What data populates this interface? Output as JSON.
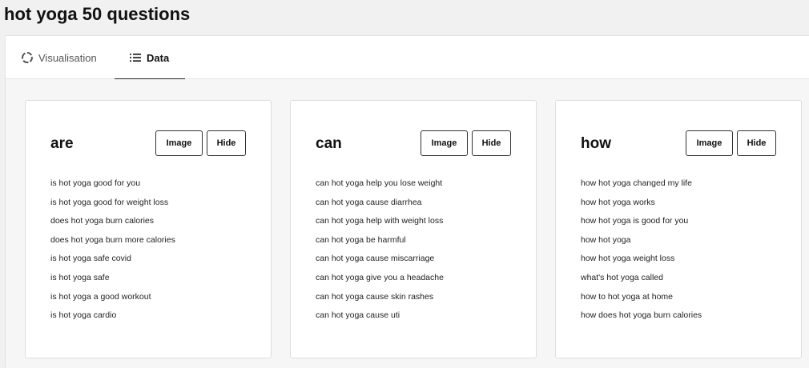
{
  "header": {
    "keyword": "hot yoga",
    "suffix": "50 questions"
  },
  "tabs": [
    {
      "label": "Visualisation",
      "icon": "loading-circle-icon",
      "active": false
    },
    {
      "label": "Data",
      "icon": "list-icon",
      "active": true
    }
  ],
  "cards": [
    {
      "title": "are",
      "image_label": "Image",
      "hide_label": "Hide",
      "questions": [
        "is hot yoga good for you",
        "is hot yoga good for weight loss",
        "does hot yoga burn calories",
        "does hot yoga burn more calories",
        "is hot yoga safe covid",
        "is hot yoga safe",
        "is hot yoga a good workout",
        "is hot yoga cardio"
      ]
    },
    {
      "title": "can",
      "image_label": "Image",
      "hide_label": "Hide",
      "questions": [
        "can hot yoga help you lose weight",
        "can hot yoga cause diarrhea",
        "can hot yoga help with weight loss",
        "can hot yoga be harmful",
        "can hot yoga cause miscarriage",
        "can hot yoga give you a headache",
        "can hot yoga cause skin rashes",
        "can hot yoga cause uti"
      ]
    },
    {
      "title": "how",
      "image_label": "Image",
      "hide_label": "Hide",
      "questions": [
        "how hot yoga changed my life",
        "how hot yoga works",
        "how hot yoga is good for you",
        "how hot yoga",
        "how hot yoga weight loss",
        "what's hot yoga called",
        "how to hot yoga at home",
        "how does hot yoga burn calories"
      ]
    }
  ]
}
